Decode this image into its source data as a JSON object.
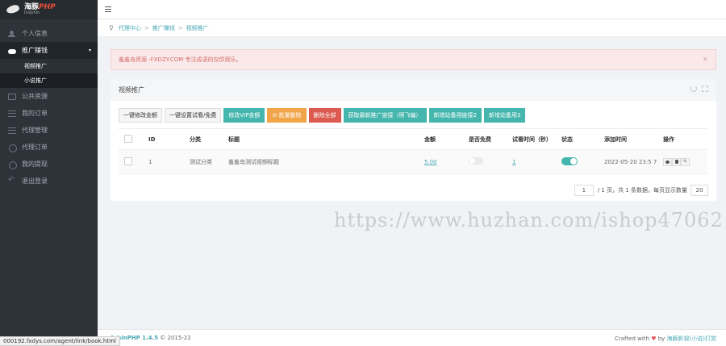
{
  "logo": {
    "name": "海豚",
    "php": "PHP",
    "sub": "Dolphin"
  },
  "sidebar": {
    "items": [
      {
        "label": "个人信息",
        "icon": "user-icon"
      },
      {
        "label": "推广赚钱",
        "icon": "cloud-icon",
        "active": true,
        "arrow": "▾",
        "children": [
          {
            "label": "视频推广",
            "current": true
          },
          {
            "label": "小说推广"
          }
        ]
      },
      {
        "label": "公共资源",
        "icon": "box-icon"
      },
      {
        "label": "我的订单",
        "icon": "list-icon"
      },
      {
        "label": "代理管理",
        "icon": "list-icon"
      },
      {
        "label": "代理订单",
        "icon": "coin-icon"
      },
      {
        "label": "我的提现",
        "icon": "coin-icon"
      },
      {
        "label": "退出登录",
        "icon": "logout-icon"
      }
    ]
  },
  "breadcrumb": {
    "home_icon": "♀",
    "items": [
      "代理中心",
      "推广赚钱",
      "视频推广"
    ],
    "sep": ">"
  },
  "alert": {
    "text": "羞羞岛资源 -FXDZY.COM 专注成语的仅供观乐。",
    "close": "×"
  },
  "panel": {
    "title": "视频推广"
  },
  "toolbar": {
    "buttons": [
      {
        "label": "一键修改金额",
        "style": "default"
      },
      {
        "label": "一键设置试看/免费",
        "style": "default"
      },
      {
        "label": "修改VIP金额",
        "style": "teal"
      },
      {
        "label": "⊘ 批量删除",
        "style": "orange"
      },
      {
        "label": "删除全部",
        "style": "red"
      },
      {
        "label": "获取最新推广链接（明飞编）",
        "style": "teal"
      },
      {
        "label": "新增站备用链接2",
        "style": "teal"
      },
      {
        "label": "新增站备用3",
        "style": "teal"
      }
    ]
  },
  "table": {
    "columns": [
      "ID",
      "分类",
      "标题",
      "金额",
      "是否免费",
      "试看时间（秒）",
      "状态",
      "添加时间",
      "操作"
    ],
    "rows": [
      {
        "id": "1",
        "category": "测试分类",
        "title": "羞羞岛测试视频标题",
        "amount": "5.00",
        "free": false,
        "preview": "1",
        "status": true,
        "added": "2022-05-20 23:5 7"
      }
    ]
  },
  "pager": {
    "page": "1",
    "text": "/ 1 页，共 1 条数据，每页显示数量",
    "size": "20"
  },
  "watermark": "https://www.huzhan.com/ishop47062",
  "footer": {
    "left_brand": "olphinPHP 1.4.5",
    "left_rest": " © 2015-22",
    "right_prefix": "Crafted with",
    "heart": "♥",
    "right_by": " by ",
    "right_brand": "海豚影视(小说)打赏"
  },
  "status_url": "000192.fxdys.com/agent/link/book.html"
}
